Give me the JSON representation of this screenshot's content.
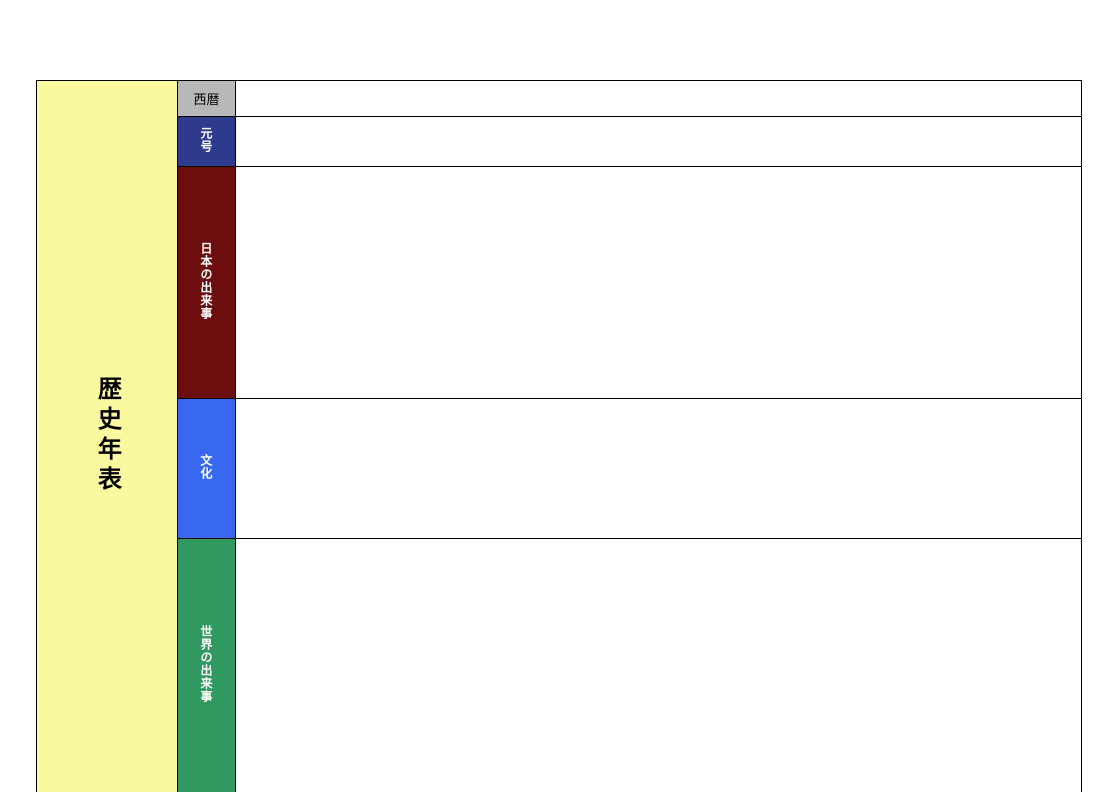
{
  "title": "歴史年表",
  "rows": {
    "seireki": {
      "label": "西暦"
    },
    "gengo": {
      "label": "元号"
    },
    "japan": {
      "label": "日本の出来事"
    },
    "culture": {
      "label": "文化"
    },
    "world": {
      "label": "世界の出来事"
    }
  }
}
